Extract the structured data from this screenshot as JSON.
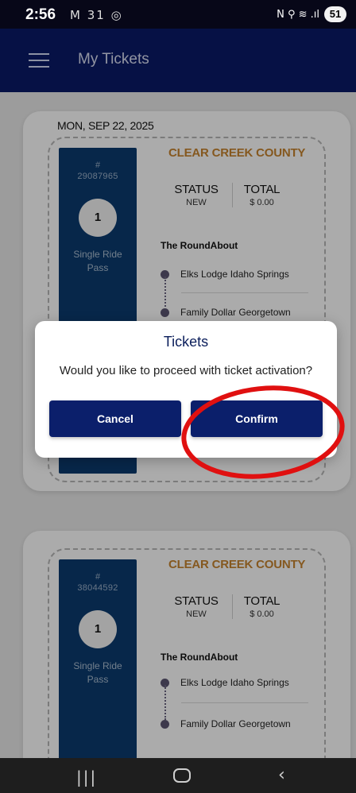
{
  "status_bar": {
    "time": "2:56",
    "notification_icons": "M 31 ◎",
    "system_icons": "N ⚲ ≋ .ıl",
    "battery": "51"
  },
  "app_bar": {
    "title": "My Tickets"
  },
  "tickets": [
    {
      "date": "MON, SEP 22, 2025",
      "hash": "#",
      "number": "29087965",
      "quantity": "1",
      "pass_type_line1": "Single Ride",
      "pass_type_line2": "Pass",
      "agency": "CLEAR CREEK COUNTY",
      "status_label": "STATUS",
      "status_value": "NEW",
      "total_label": "TOTAL",
      "total_value": "$ 0.00",
      "route": "The RoundAbout",
      "from_stop": "Elks Lodge Idaho Springs",
      "to_stop": "Family Dollar Georgetown"
    },
    {
      "hash": "#",
      "number": "38044592",
      "quantity": "1",
      "pass_type_line1": "Single Ride",
      "pass_type_line2": "Pass",
      "agency": "CLEAR CREEK COUNTY",
      "status_label": "STATUS",
      "status_value": "NEW",
      "total_label": "TOTAL",
      "total_value": "$ 0.00",
      "route": "The RoundAbout",
      "from_stop": "Elks Lodge Idaho Springs",
      "to_stop": "Family Dollar Georgetown"
    }
  ],
  "dialog": {
    "title": "Tickets",
    "message": "Would you like to proceed with ticket activation?",
    "cancel_label": "Cancel",
    "confirm_label": "Confirm"
  },
  "nav_bar": {
    "recent": "|||",
    "back": "‹"
  },
  "colors": {
    "app_bar": "#0a1a66",
    "ticket_stub": "#0b3a6e",
    "agency_text": "#c4822e",
    "dialog_button": "#0b1f6b",
    "highlight_circle": "#e01010"
  }
}
